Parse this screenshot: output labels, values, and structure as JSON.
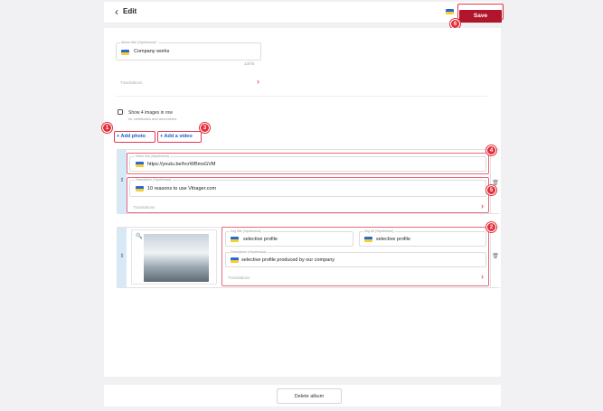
{
  "header": {
    "back_icon": "chevron-left-icon",
    "title": "Edit",
    "save_label": "Save"
  },
  "album": {
    "label": "Album title (Українська)*",
    "value": "Company works",
    "counter": "13/75",
    "translations_label": "Translations"
  },
  "options": {
    "show4_label": "Show 4 images in row",
    "show4_sub": "for certificates and documents"
  },
  "buttons": {
    "add_photo": "+ Add photo",
    "add_video": "+ Add a video"
  },
  "video_block": {
    "link_label": "Video link (Українська)",
    "link_value": "https://youtu.be/hcrWBmsGVM",
    "desc_label": "Description (Українська)",
    "desc_value": "10 reasons to use Vitrager.com",
    "translations_label": "Translations"
  },
  "image_block": {
    "title_label": "Img title (Українська)",
    "title_value": "selective profile",
    "alt_label": "Img alt (Українська)",
    "alt_value": "selective profile",
    "desc_label": "Description (Українська)",
    "desc_value": "selective profile produced by our company",
    "translations_label": "Translations"
  },
  "badges": [
    "1",
    "2",
    "3",
    "4",
    "5",
    "6"
  ],
  "footer": {
    "delete_label": "Delete album"
  },
  "colors": {
    "accent_red": "#b0152b",
    "badge_red": "#e32f3a",
    "link_blue": "#1f5fbf",
    "flag_blue": "#2b67d8",
    "flag_yellow": "#f5cf2a"
  }
}
